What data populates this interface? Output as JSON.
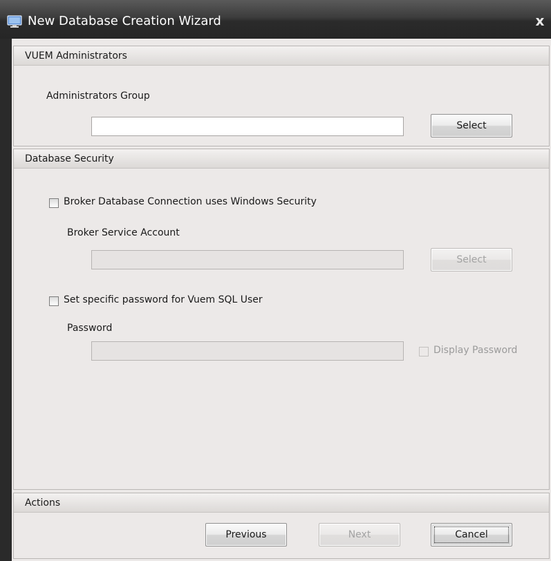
{
  "window": {
    "title": "New Database Creation Wizard",
    "close_glyph": "x",
    "icon": "monitor-app-icon"
  },
  "admins_panel": {
    "header": "VUEM Administrators",
    "group_label": "Administrators Group",
    "group_value": "",
    "select_label": "Select"
  },
  "security_panel": {
    "header": "Database Security",
    "windows_security_label": "Broker Database Connection uses Windows Security",
    "windows_security_checked": false,
    "service_account_label": "Broker Service Account",
    "service_account_value": "",
    "service_select_label": "Select",
    "sql_password_label": "Set specific password for Vuem SQL User",
    "sql_password_checked": false,
    "password_label": "Password",
    "password_value": "",
    "display_password_label": "Display Password"
  },
  "actions_panel": {
    "header": "Actions",
    "previous_label": "Previous",
    "next_label": "Next",
    "cancel_label": "Cancel"
  }
}
